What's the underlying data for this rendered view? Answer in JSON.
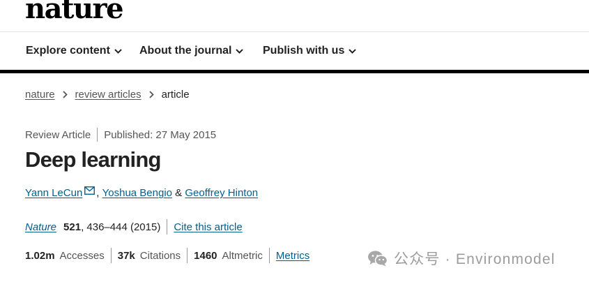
{
  "header": {
    "logo": "nature",
    "nav": [
      {
        "label": "Explore content"
      },
      {
        "label": "About the journal"
      },
      {
        "label": "Publish with us"
      }
    ]
  },
  "breadcrumb": {
    "items": [
      "nature",
      "review articles"
    ],
    "current": "article"
  },
  "article": {
    "type": "Review Article",
    "published": "Published: 27 May 2015",
    "title": "Deep learning",
    "authors": [
      "Yann LeCun",
      "Yoshua Bengio",
      "Geoffrey Hinton"
    ],
    "author_sep_1": ", ",
    "author_sep_2": " & ",
    "journal": "Nature",
    "volume": "521",
    "pages_year": ", 436–444 (2015)",
    "cite_label": "Cite this article"
  },
  "metrics": {
    "accesses_value": "1.02m",
    "accesses_label": "Accesses",
    "citations_value": "37k",
    "citations_label": "Citations",
    "altmetric_value": "1460",
    "altmetric_label": "Altmetric",
    "link_label": "Metrics"
  },
  "watermark": {
    "text": "公众号 · Environmodel"
  },
  "colors": {
    "link": "#025e8d",
    "text": "#222222",
    "muted": "#555555"
  }
}
